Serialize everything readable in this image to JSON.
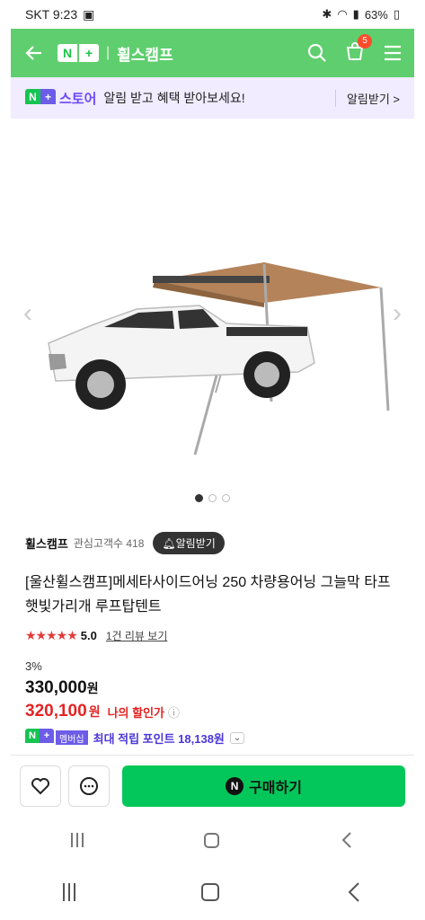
{
  "status_bar": {
    "carrier_time": "SKT 9:23",
    "battery": "63%"
  },
  "header": {
    "store_name": "휠스캠프",
    "cart_count": "5"
  },
  "notice": {
    "label": "스토어",
    "message": "알림 받고 혜택 받아보세요!",
    "action": "알림받기 >"
  },
  "seller": {
    "name": "휠스캠프",
    "fans": "관심고객수 418",
    "alarm_button": "알림받기"
  },
  "product": {
    "title": "[울산휠스캠프]메세타사이드어닝 250 차량용어닝 그늘막 타프 햇빛가리개 루프탑텐트",
    "stars": "★★★★★",
    "rating": "5.0",
    "review_link": "1건 리뷰 보기",
    "discount_rate": "3%",
    "original_price": "330,000",
    "price_unit": "원",
    "sale_price": "320,100",
    "my_discount_label": "나의 할인가",
    "membership_label": "멤버십",
    "points_text": "최대 적립 포인트 18,138원"
  },
  "bottom": {
    "buy_label": "구매하기"
  },
  "carousel": {
    "total": 3,
    "active": 0
  }
}
